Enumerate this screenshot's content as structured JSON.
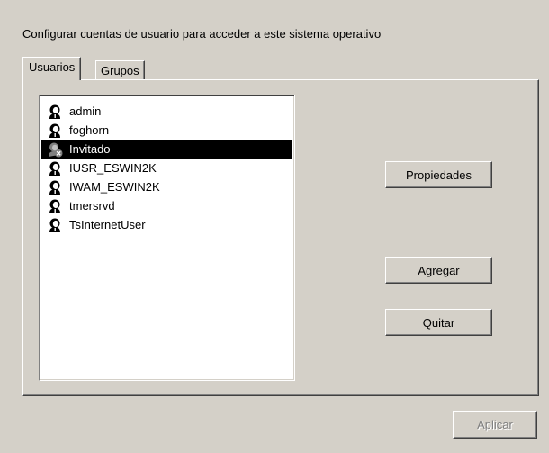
{
  "heading": "Configurar cuentas de usuario para acceder a este sistema operativo",
  "tabs": [
    {
      "label": "Usuarios",
      "active": true
    },
    {
      "label": "Grupos",
      "active": false
    }
  ],
  "users": [
    {
      "name": "admin",
      "icon": "user-icon",
      "selected": false
    },
    {
      "name": "foghorn",
      "icon": "user-icon",
      "selected": false
    },
    {
      "name": "Invitado",
      "icon": "disabled-user-icon",
      "selected": true
    },
    {
      "name": "IUSR_ESWIN2K",
      "icon": "user-icon",
      "selected": false
    },
    {
      "name": "IWAM_ESWIN2K",
      "icon": "user-icon",
      "selected": false
    },
    {
      "name": "tmersrvd",
      "icon": "user-icon",
      "selected": false
    },
    {
      "name": "TsInternetUser",
      "icon": "user-icon",
      "selected": false
    }
  ],
  "buttons": {
    "properties": "Propiedades",
    "add": "Agregar",
    "remove": "Quitar",
    "apply": "Aplicar"
  },
  "colors": {
    "face": "#d4d0c8",
    "selection": "#000000",
    "disabled_text": "#808080"
  }
}
